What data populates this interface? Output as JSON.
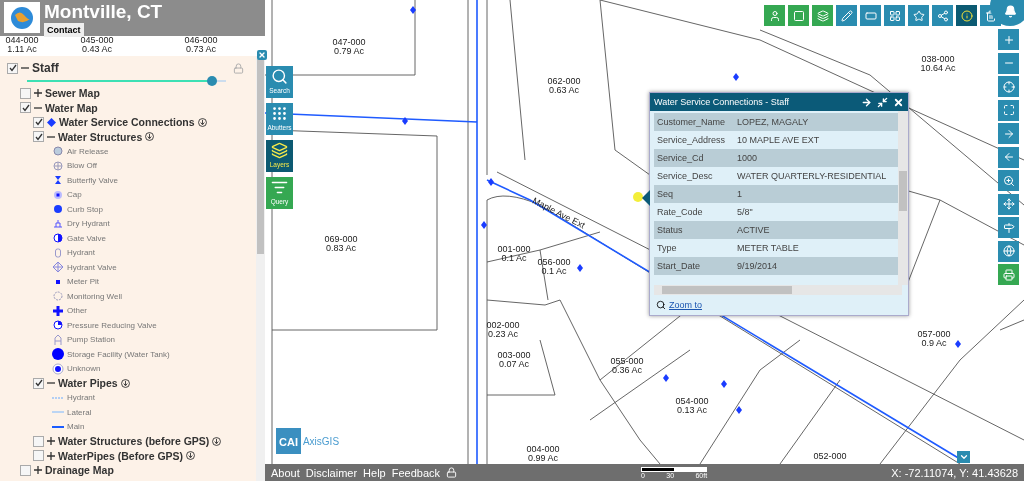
{
  "header": {
    "title": "Montville, CT",
    "contact": "Contact"
  },
  "layer_panel": {
    "layers": [
      {
        "label": "Staff",
        "kind": "group",
        "checked": true,
        "expanded": true,
        "opacity_slider": {
          "level": 0.93
        },
        "children": [
          {
            "label": "Sewer Map",
            "kind": "group",
            "checked": false,
            "expanded": false
          },
          {
            "label": "Water Map",
            "kind": "group",
            "checked": true,
            "expanded": true,
            "children": [
              {
                "label": "Water Service Connections",
                "kind": "layer",
                "checked": true,
                "info": true
              },
              {
                "label": "Water Structures",
                "kind": "group",
                "checked": true,
                "expanded": true,
                "info": true,
                "children": [
                  {
                    "label": "Air Release",
                    "kind": "symbol"
                  },
                  {
                    "label": "Blow Off",
                    "kind": "symbol"
                  },
                  {
                    "label": "Butterfly Valve",
                    "kind": "symbol"
                  },
                  {
                    "label": "Cap",
                    "kind": "symbol"
                  },
                  {
                    "label": "Curb Stop",
                    "kind": "symbol"
                  },
                  {
                    "label": "Dry Hydrant",
                    "kind": "symbol"
                  },
                  {
                    "label": "Gate Valve",
                    "kind": "symbol"
                  },
                  {
                    "label": "Hydrant",
                    "kind": "symbol"
                  },
                  {
                    "label": "Hydrant Valve",
                    "kind": "symbol"
                  },
                  {
                    "label": "Meter Pit",
                    "kind": "symbol"
                  },
                  {
                    "label": "Monitoring Well",
                    "kind": "symbol"
                  },
                  {
                    "label": "Other",
                    "kind": "symbol"
                  },
                  {
                    "label": "Pressure Reducing Valve",
                    "kind": "symbol"
                  },
                  {
                    "label": "Pump Station",
                    "kind": "symbol"
                  },
                  {
                    "label": "Storage Facility (Water Tank)",
                    "kind": "symbol"
                  },
                  {
                    "label": "Unknown",
                    "kind": "symbol"
                  }
                ]
              },
              {
                "label": "Water Pipes",
                "kind": "group",
                "checked": true,
                "expanded": true,
                "info": true,
                "children": [
                  {
                    "label": "Hydrant",
                    "kind": "line"
                  },
                  {
                    "label": "Lateral",
                    "kind": "line"
                  },
                  {
                    "label": "Main",
                    "kind": "line"
                  }
                ]
              },
              {
                "label": "Water Structures (before GPS)",
                "kind": "group",
                "checked": false,
                "expanded": false,
                "info": true
              },
              {
                "label": "WaterPipes (Before GPS)",
                "kind": "group",
                "checked": false,
                "expanded": false,
                "info": true
              }
            ]
          },
          {
            "label": "Drainage Map",
            "kind": "group",
            "checked": false,
            "expanded": false
          }
        ]
      }
    ]
  },
  "side_tools": [
    {
      "label": "Search",
      "selected": false,
      "color": "#2a8cb0"
    },
    {
      "label": "Abutters",
      "selected": false,
      "color": "#2a8cb0"
    },
    {
      "label": "Layers",
      "selected": true,
      "color": "#0c5a72"
    },
    {
      "label": "Query",
      "selected": false,
      "color": "#35a852"
    }
  ],
  "toolbar": {
    "buttons": [
      {
        "color": "#35a852"
      },
      {
        "color": "#35a852"
      },
      {
        "color": "#35a852"
      },
      {
        "color": "#2a8cb0"
      },
      {
        "color": "#2a8cb0"
      },
      {
        "color": "#2a8cb0"
      },
      {
        "color": "#2a8cb0"
      },
      {
        "color": "#2a8cb0"
      },
      {
        "color": "#0c5a72"
      },
      {
        "color": "#2a8cb0"
      }
    ]
  },
  "map_tools": {
    "buttons": [
      {
        "color": "#2a8cb0"
      },
      {
        "color": "#2a8cb0"
      },
      {
        "color": "#2a8cb0"
      },
      {
        "color": "#2a8cb0"
      },
      {
        "color": "#2a8cb0"
      },
      {
        "color": "#2a8cb0"
      },
      {
        "color": "#2a8cb0"
      },
      {
        "color": "#2a8cb0"
      },
      {
        "color": "#2a8cb0"
      },
      {
        "color": "#2a8cb0"
      },
      {
        "color": "#35a852"
      }
    ]
  },
  "map": {
    "street_label": "Maple Ave Ext",
    "parcels": [
      {
        "id": "044-000",
        "area": "1.11 Ac"
      },
      {
        "id": "045-000",
        "area": "0.43 Ac"
      },
      {
        "id": "046-000",
        "area": "0.73 Ac"
      },
      {
        "id": "047-000",
        "area": "0.79 Ac"
      },
      {
        "id": "062-000",
        "area": "0.63 Ac"
      },
      {
        "id": "038-000",
        "area": "10.64 Ac"
      },
      {
        "id": "069-000",
        "area": "0.83 Ac"
      },
      {
        "id": "001-000",
        "area": "0.1 Ac"
      },
      {
        "id": "056-000",
        "area": "0.1 Ac"
      },
      {
        "id": "002-000",
        "area": "0.23 Ac"
      },
      {
        "id": "003-000",
        "area": "0.07 Ac"
      },
      {
        "id": "055-000",
        "area": "0.36 Ac"
      },
      {
        "id": "054-000",
        "area": "0.13 Ac"
      },
      {
        "id": "057-000",
        "area": "0.9 Ac"
      },
      {
        "id": "004-000",
        "area": "0.99 Ac"
      },
      {
        "id": "052-000"
      }
    ]
  },
  "popup": {
    "title": "Water Service Connections - Staff",
    "zoom_link": "Zoom to",
    "rows": [
      {
        "field": "Customer_Name",
        "value": "LOPEZ, MAGALY"
      },
      {
        "field": "Service_Address",
        "value": "10 MAPLE AVE EXT"
      },
      {
        "field": "Service_Cd",
        "value": "1000"
      },
      {
        "field": "Service_Desc",
        "value": "WATER QUARTERLY-RESIDENTIAL"
      },
      {
        "field": "Seq",
        "value": "1"
      },
      {
        "field": "Rate_Code",
        "value": "5/8\""
      },
      {
        "field": "Status",
        "value": "ACTIVE"
      },
      {
        "field": "Type",
        "value": "METER TABLE"
      },
      {
        "field": "Start_Date",
        "value": "9/19/2014"
      }
    ]
  },
  "logo": {
    "brand": "CAI",
    "product": "AxisGIS"
  },
  "footer": {
    "links": [
      "About",
      "Disclaimer",
      "Help",
      "Feedback"
    ],
    "scale_labels": [
      "0",
      "30",
      "60ft"
    ],
    "coordinates": "X: -72.11074, Y: 41.43628"
  }
}
